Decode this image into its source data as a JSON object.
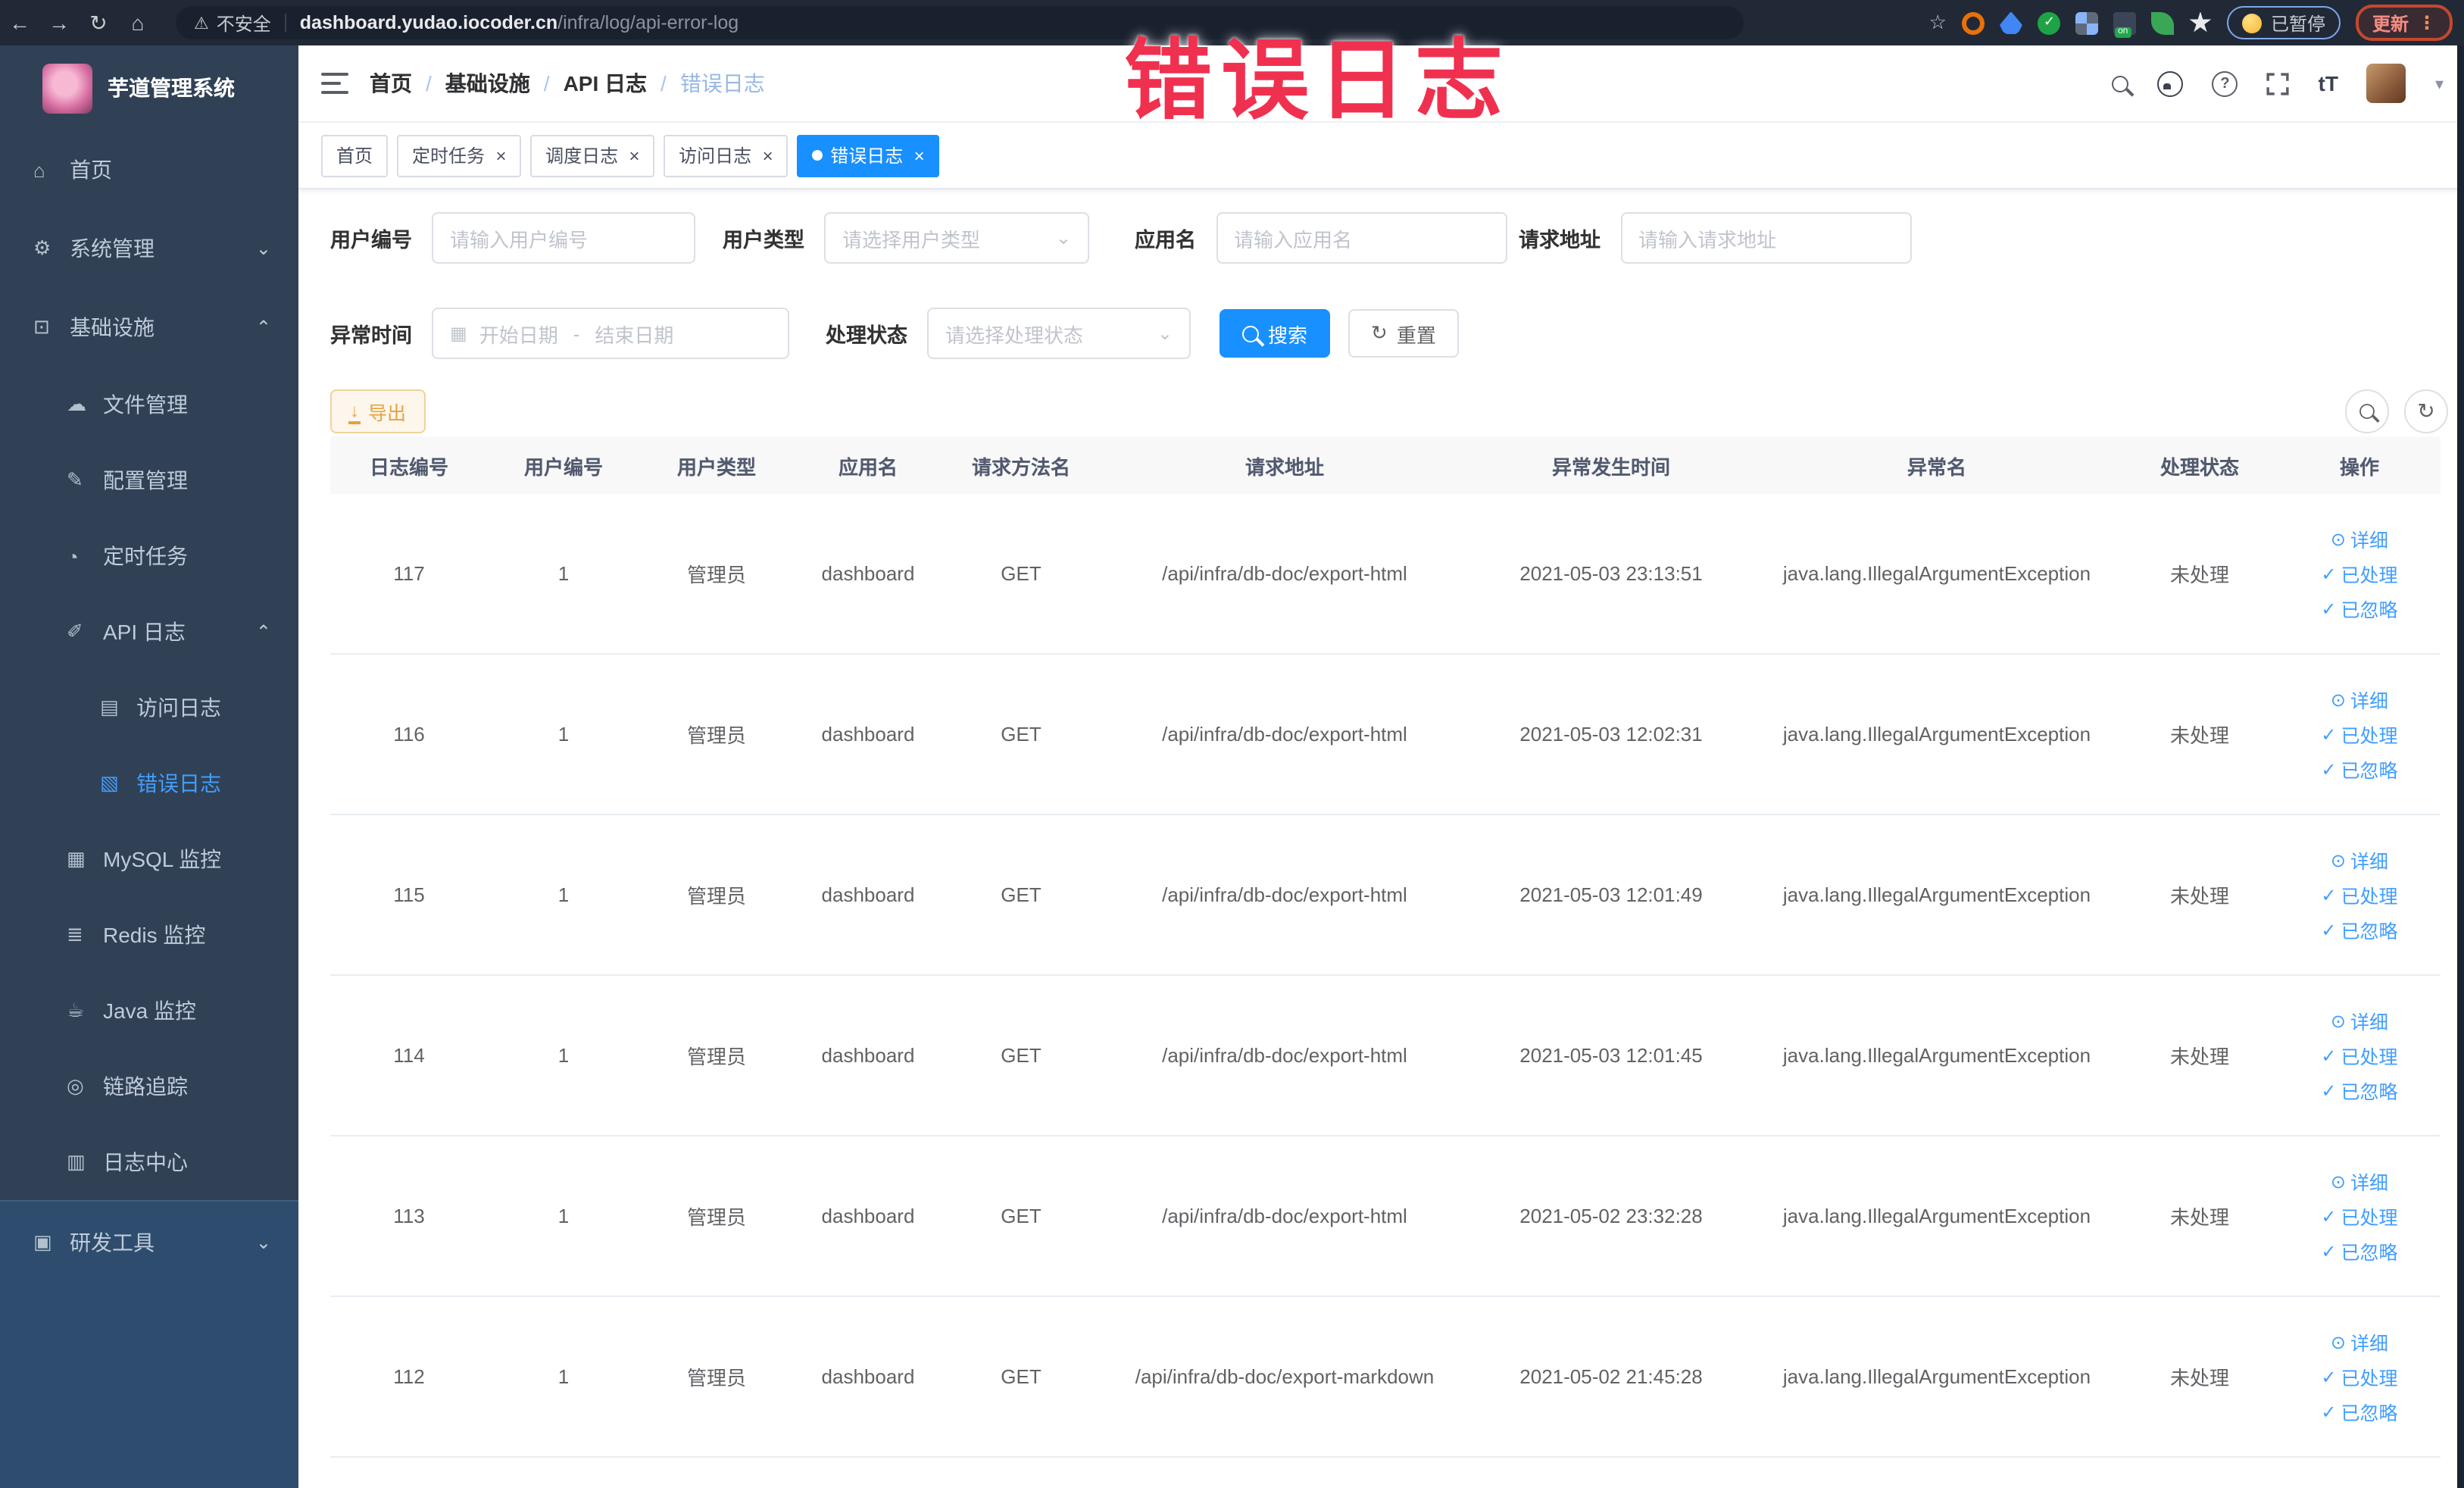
{
  "browser": {
    "security_label": "不安全",
    "url_host": "dashboard.yudao.iocoder.cn",
    "url_path": "/infra/log/api-error-log",
    "paused_label": "已暂停",
    "update_label": "更新"
  },
  "overlay": {
    "title": "错误日志",
    "color": "#f0304f"
  },
  "sidebar": {
    "app_title": "芋道管理系统",
    "items": [
      {
        "label": "首页",
        "icon": "home-icon"
      },
      {
        "label": "系统管理",
        "icon": "gear-icon",
        "chevron_down": true
      },
      {
        "label": "基础设施",
        "icon": "infrastructure-icon",
        "chevron_up": true
      },
      {
        "label": "文件管理",
        "icon": "file-manage-icon",
        "l1": true
      },
      {
        "label": "配置管理",
        "icon": "config-manage-icon",
        "l1": true
      },
      {
        "label": "定时任务",
        "icon": "scheduled-job-icon",
        "l1": true
      },
      {
        "label": "API 日志",
        "icon": "api-log-icon",
        "l1": true,
        "chevron_up": true
      },
      {
        "label": "访问日志",
        "icon": "access-log-icon",
        "l2": true
      },
      {
        "label": "错误日志",
        "icon": "error-log-icon",
        "l2": true,
        "active": true
      },
      {
        "label": "MySQL 监控",
        "icon": "mysql-monitor-icon",
        "l1": true
      },
      {
        "label": "Redis 监控",
        "icon": "redis-monitor-icon",
        "l1": true
      },
      {
        "label": "Java 监控",
        "icon": "java-monitor-icon",
        "l1": true
      },
      {
        "label": "链路追踪",
        "icon": "trace-icon",
        "l1": true
      },
      {
        "label": "日志中心",
        "icon": "log-center-icon",
        "l1": true
      },
      {
        "label": "研发工具",
        "icon": "dev-tool-icon",
        "chevron_down": true,
        "light": true
      }
    ]
  },
  "breadcrumb": {
    "items": [
      "首页",
      "基础设施",
      "API 日志",
      "错误日志"
    ]
  },
  "tabs": [
    {
      "label": "首页",
      "closable": false,
      "active": false
    },
    {
      "label": "定时任务",
      "closable": true,
      "active": false
    },
    {
      "label": "调度日志",
      "closable": true,
      "active": false
    },
    {
      "label": "访问日志",
      "closable": true,
      "active": false
    },
    {
      "label": "错误日志",
      "closable": true,
      "active": true
    }
  ],
  "filters": {
    "user_id": {
      "label": "用户编号",
      "placeholder": "请输入用户编号"
    },
    "user_type": {
      "label": "用户类型",
      "placeholder": "请选择用户类型"
    },
    "app_name": {
      "label": "应用名",
      "placeholder": "请输入应用名"
    },
    "request_url": {
      "label": "请求地址",
      "placeholder": "请输入请求地址"
    },
    "exception_time": {
      "label": "异常时间",
      "start_placeholder": "开始日期",
      "separator": "-",
      "end_placeholder": "结束日期"
    },
    "process_status": {
      "label": "处理状态",
      "placeholder": "请选择处理状态"
    },
    "search_label": "搜索",
    "reset_label": "重置"
  },
  "toolbar": {
    "export_label": "导出"
  },
  "table": {
    "columns": [
      "日志编号",
      "用户编号",
      "用户类型",
      "应用名",
      "请求方法名",
      "请求地址",
      "异常发生时间",
      "异常名",
      "处理状态",
      "操作"
    ],
    "actions": [
      "详细",
      "已处理",
      "已忽略"
    ],
    "rows": [
      {
        "id": "117",
        "user_id": "1",
        "user_type": "管理员",
        "app": "dashboard",
        "method": "GET",
        "url": "/api/infra/db-doc/export-html",
        "time": "2021-05-03 23:13:51",
        "exception": "java.lang.IllegalArgumentException",
        "status": "未处理"
      },
      {
        "id": "116",
        "user_id": "1",
        "user_type": "管理员",
        "app": "dashboard",
        "method": "GET",
        "url": "/api/infra/db-doc/export-html",
        "time": "2021-05-03 12:02:31",
        "exception": "java.lang.IllegalArgumentException",
        "status": "未处理"
      },
      {
        "id": "115",
        "user_id": "1",
        "user_type": "管理员",
        "app": "dashboard",
        "method": "GET",
        "url": "/api/infra/db-doc/export-html",
        "time": "2021-05-03 12:01:49",
        "exception": "java.lang.IllegalArgumentException",
        "status": "未处理"
      },
      {
        "id": "114",
        "user_id": "1",
        "user_type": "管理员",
        "app": "dashboard",
        "method": "GET",
        "url": "/api/infra/db-doc/export-html",
        "time": "2021-05-03 12:01:45",
        "exception": "java.lang.IllegalArgumentException",
        "status": "未处理"
      },
      {
        "id": "113",
        "user_id": "1",
        "user_type": "管理员",
        "app": "dashboard",
        "method": "GET",
        "url": "/api/infra/db-doc/export-html",
        "time": "2021-05-02 23:32:28",
        "exception": "java.lang.IllegalArgumentException",
        "status": "未处理"
      },
      {
        "id": "112",
        "user_id": "1",
        "user_type": "管理员",
        "app": "dashboard",
        "method": "GET",
        "url": "/api/infra/db-doc/export-markdown",
        "time": "2021-05-02 21:45:28",
        "exception": "java.lang.IllegalArgumentException",
        "status": "未处理"
      }
    ]
  },
  "colors": {
    "accent": "#1890ff",
    "sidebar_bg": "#304156",
    "warning": "#e6a23c",
    "overlay_red": "#f0304f",
    "link_blue": "#409eff"
  }
}
